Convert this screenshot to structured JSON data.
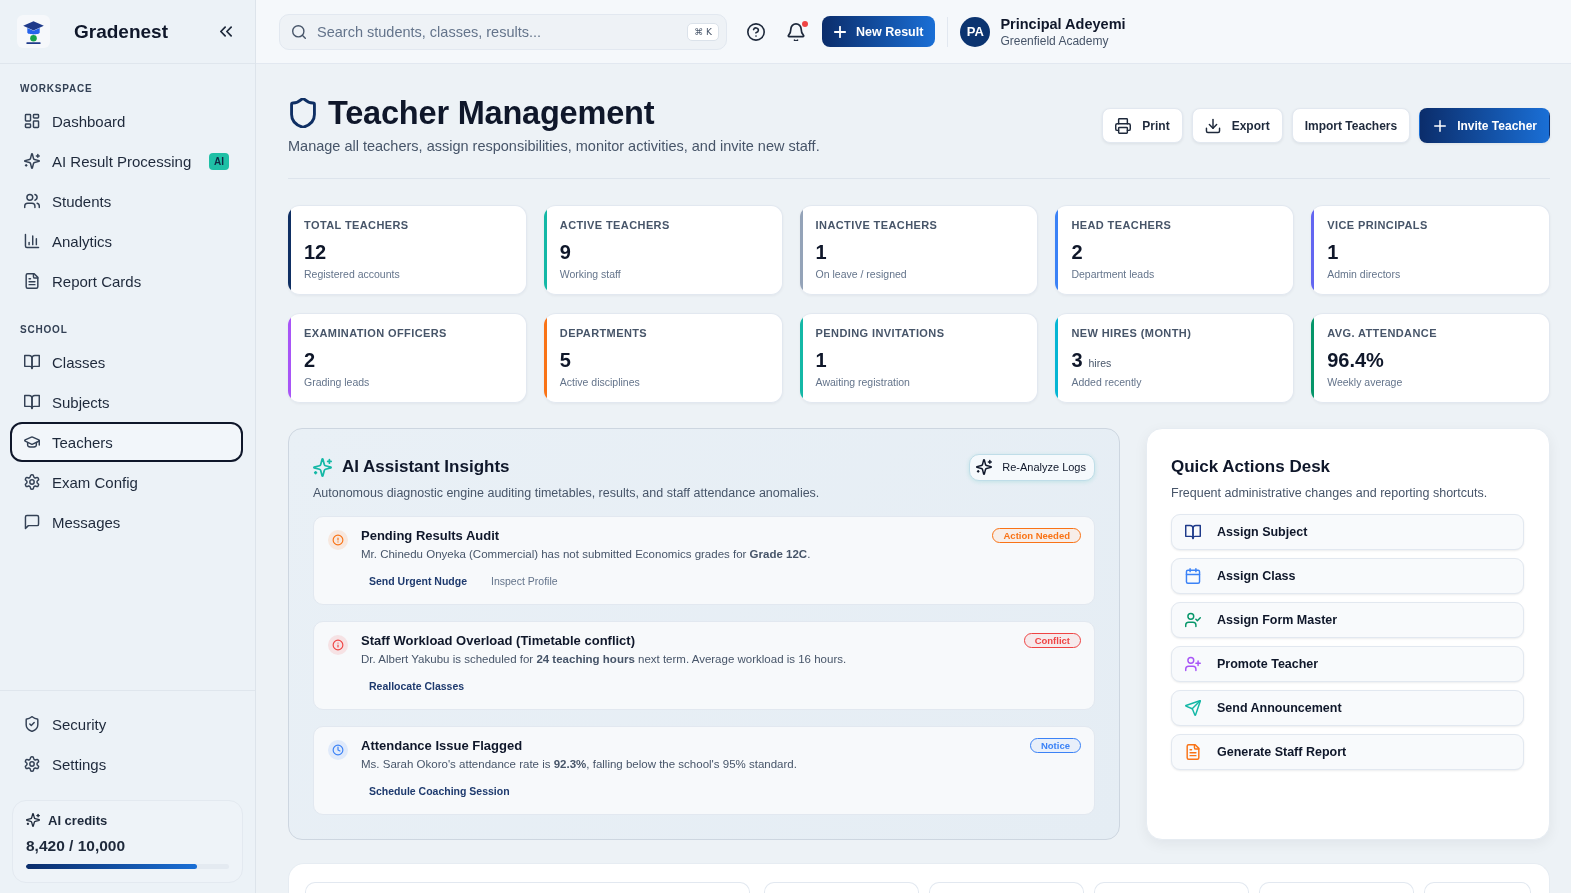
{
  "sidebar": {
    "brand": "Gradenest",
    "sections": [
      {
        "title": "WORKSPACE",
        "items": [
          {
            "label": "Dashboard",
            "selected": false
          },
          {
            "label": "AI Result Processing",
            "badge": "AI",
            "selected": false
          },
          {
            "label": "Students",
            "selected": false
          },
          {
            "label": "Analytics",
            "selected": false
          },
          {
            "label": "Report Cards",
            "selected": false
          }
        ]
      },
      {
        "title": "SCHOOL",
        "items": [
          {
            "label": "Classes",
            "selected": false
          },
          {
            "label": "Subjects",
            "selected": false
          },
          {
            "label": "Teachers",
            "selected": true
          },
          {
            "label": "Exam Config",
            "selected": false
          },
          {
            "label": "Messages",
            "selected": false
          }
        ]
      }
    ],
    "footer_items": [
      {
        "label": "Security",
        "selected": false
      },
      {
        "label": "Settings",
        "selected": false
      }
    ],
    "credits": {
      "label": "AI credits",
      "value": "8,420 / 10,000",
      "level": 0.842
    }
  },
  "topbar": {
    "search": {
      "placeholder": "Search students, classes, results...",
      "shortcut": "⌘ K"
    },
    "notifications": {
      "unread": true
    },
    "new_button": "New Result",
    "user": {
      "initials": "PA",
      "name": "Principal Adeyemi",
      "school": "Greenfield Academy"
    }
  },
  "page": {
    "title": "Teacher Management",
    "subtitle": "Manage all teachers, assign responsibilities, monitor activities, and invite new staff.",
    "actions": [
      {
        "label": "Print",
        "primary": false
      },
      {
        "label": "Export",
        "primary": false
      },
      {
        "label": "Import Teachers",
        "primary": false
      },
      {
        "label": "Invite Teacher",
        "primary": true
      }
    ]
  },
  "stats": [
    {
      "label": "TOTAL TEACHERS",
      "value": "12",
      "note": "Registered accounts",
      "color": "#0f2f63"
    },
    {
      "label": "ACTIVE TEACHERS",
      "value": "9",
      "note": "Working staff",
      "color": "#14b8a6"
    },
    {
      "label": "INACTIVE TEACHERS",
      "value": "1",
      "note": "On leave / resigned",
      "color": "#94a3b8"
    },
    {
      "label": "HEAD TEACHERS",
      "value": "2",
      "note": "Department leads",
      "color": "#3b82f6"
    },
    {
      "label": "VICE PRINCIPALS",
      "value": "1",
      "note": "Admin directors",
      "color": "#6366f1"
    },
    {
      "label": "EXAMINATION OFFICERS",
      "value": "2",
      "note": "Grading leads",
      "color": "#a855f7"
    },
    {
      "label": "DEPARTMENTS",
      "value": "5",
      "note": "Active disciplines",
      "color": "#f97316"
    },
    {
      "label": "PENDING INVITATIONS",
      "value": "1",
      "note": "Awaiting registration",
      "color": "#14b8a6"
    },
    {
      "label": "NEW HIRES (MONTH)",
      "value": "3",
      "unit": "hires",
      "note": "Added recently",
      "color": "#06b6d4"
    },
    {
      "label": "AVG. ATTENDANCE",
      "value": "96.4%",
      "note": "Weekly average",
      "color": "#059669"
    }
  ],
  "insights": {
    "title": "AI Assistant Insights",
    "subtitle": "Autonomous diagnostic engine auditing timetables, results, and staff attendance anomalies.",
    "button": "Re-Analyze Logs",
    "items": [
      {
        "title": "Pending Results Audit",
        "badge": "Action Needed",
        "color": "#f97316",
        "description": "Mr. Chinedu Onyeka (Commercial) has not submitted Economics grades for **Grade 12C**.",
        "actions": [
          {
            "label": "Send Urgent Nudge",
            "primary": true
          },
          {
            "label": "Inspect Profile",
            "primary": false
          }
        ]
      },
      {
        "title": "Staff Workload Overload (Timetable conflict)",
        "badge": "Conflict",
        "color": "#ef4444",
        "description": "Dr. Albert Yakubu is scheduled for **24 teaching hours** next term. Average workload is 16 hours.",
        "actions": [
          {
            "label": "Reallocate Classes",
            "primary": true
          }
        ]
      },
      {
        "title": "Attendance Issue Flagged",
        "badge": "Notice",
        "color": "#3b82f6",
        "description": "Ms. Sarah Okoro's attendance rate is **92.3%**, falling below the school's 95% standard.",
        "actions": [
          {
            "label": "Schedule Coaching Session",
            "primary": true
          }
        ]
      }
    ]
  },
  "quick_actions": {
    "title": "Quick Actions Desk",
    "subtitle": "Frequent administrative changes and reporting shortcuts.",
    "items": [
      {
        "label": "Assign Subject",
        "color": "#1e3a8a"
      },
      {
        "label": "Assign Class",
        "color": "#3b82f6"
      },
      {
        "label": "Assign Form Master",
        "color": "#059669"
      },
      {
        "label": "Promote Teacher",
        "color": "#a855f7"
      },
      {
        "label": "Send Announcement",
        "color": "#14b8a6"
      },
      {
        "label": "Generate Staff Report",
        "color": "#f97316"
      }
    ]
  }
}
